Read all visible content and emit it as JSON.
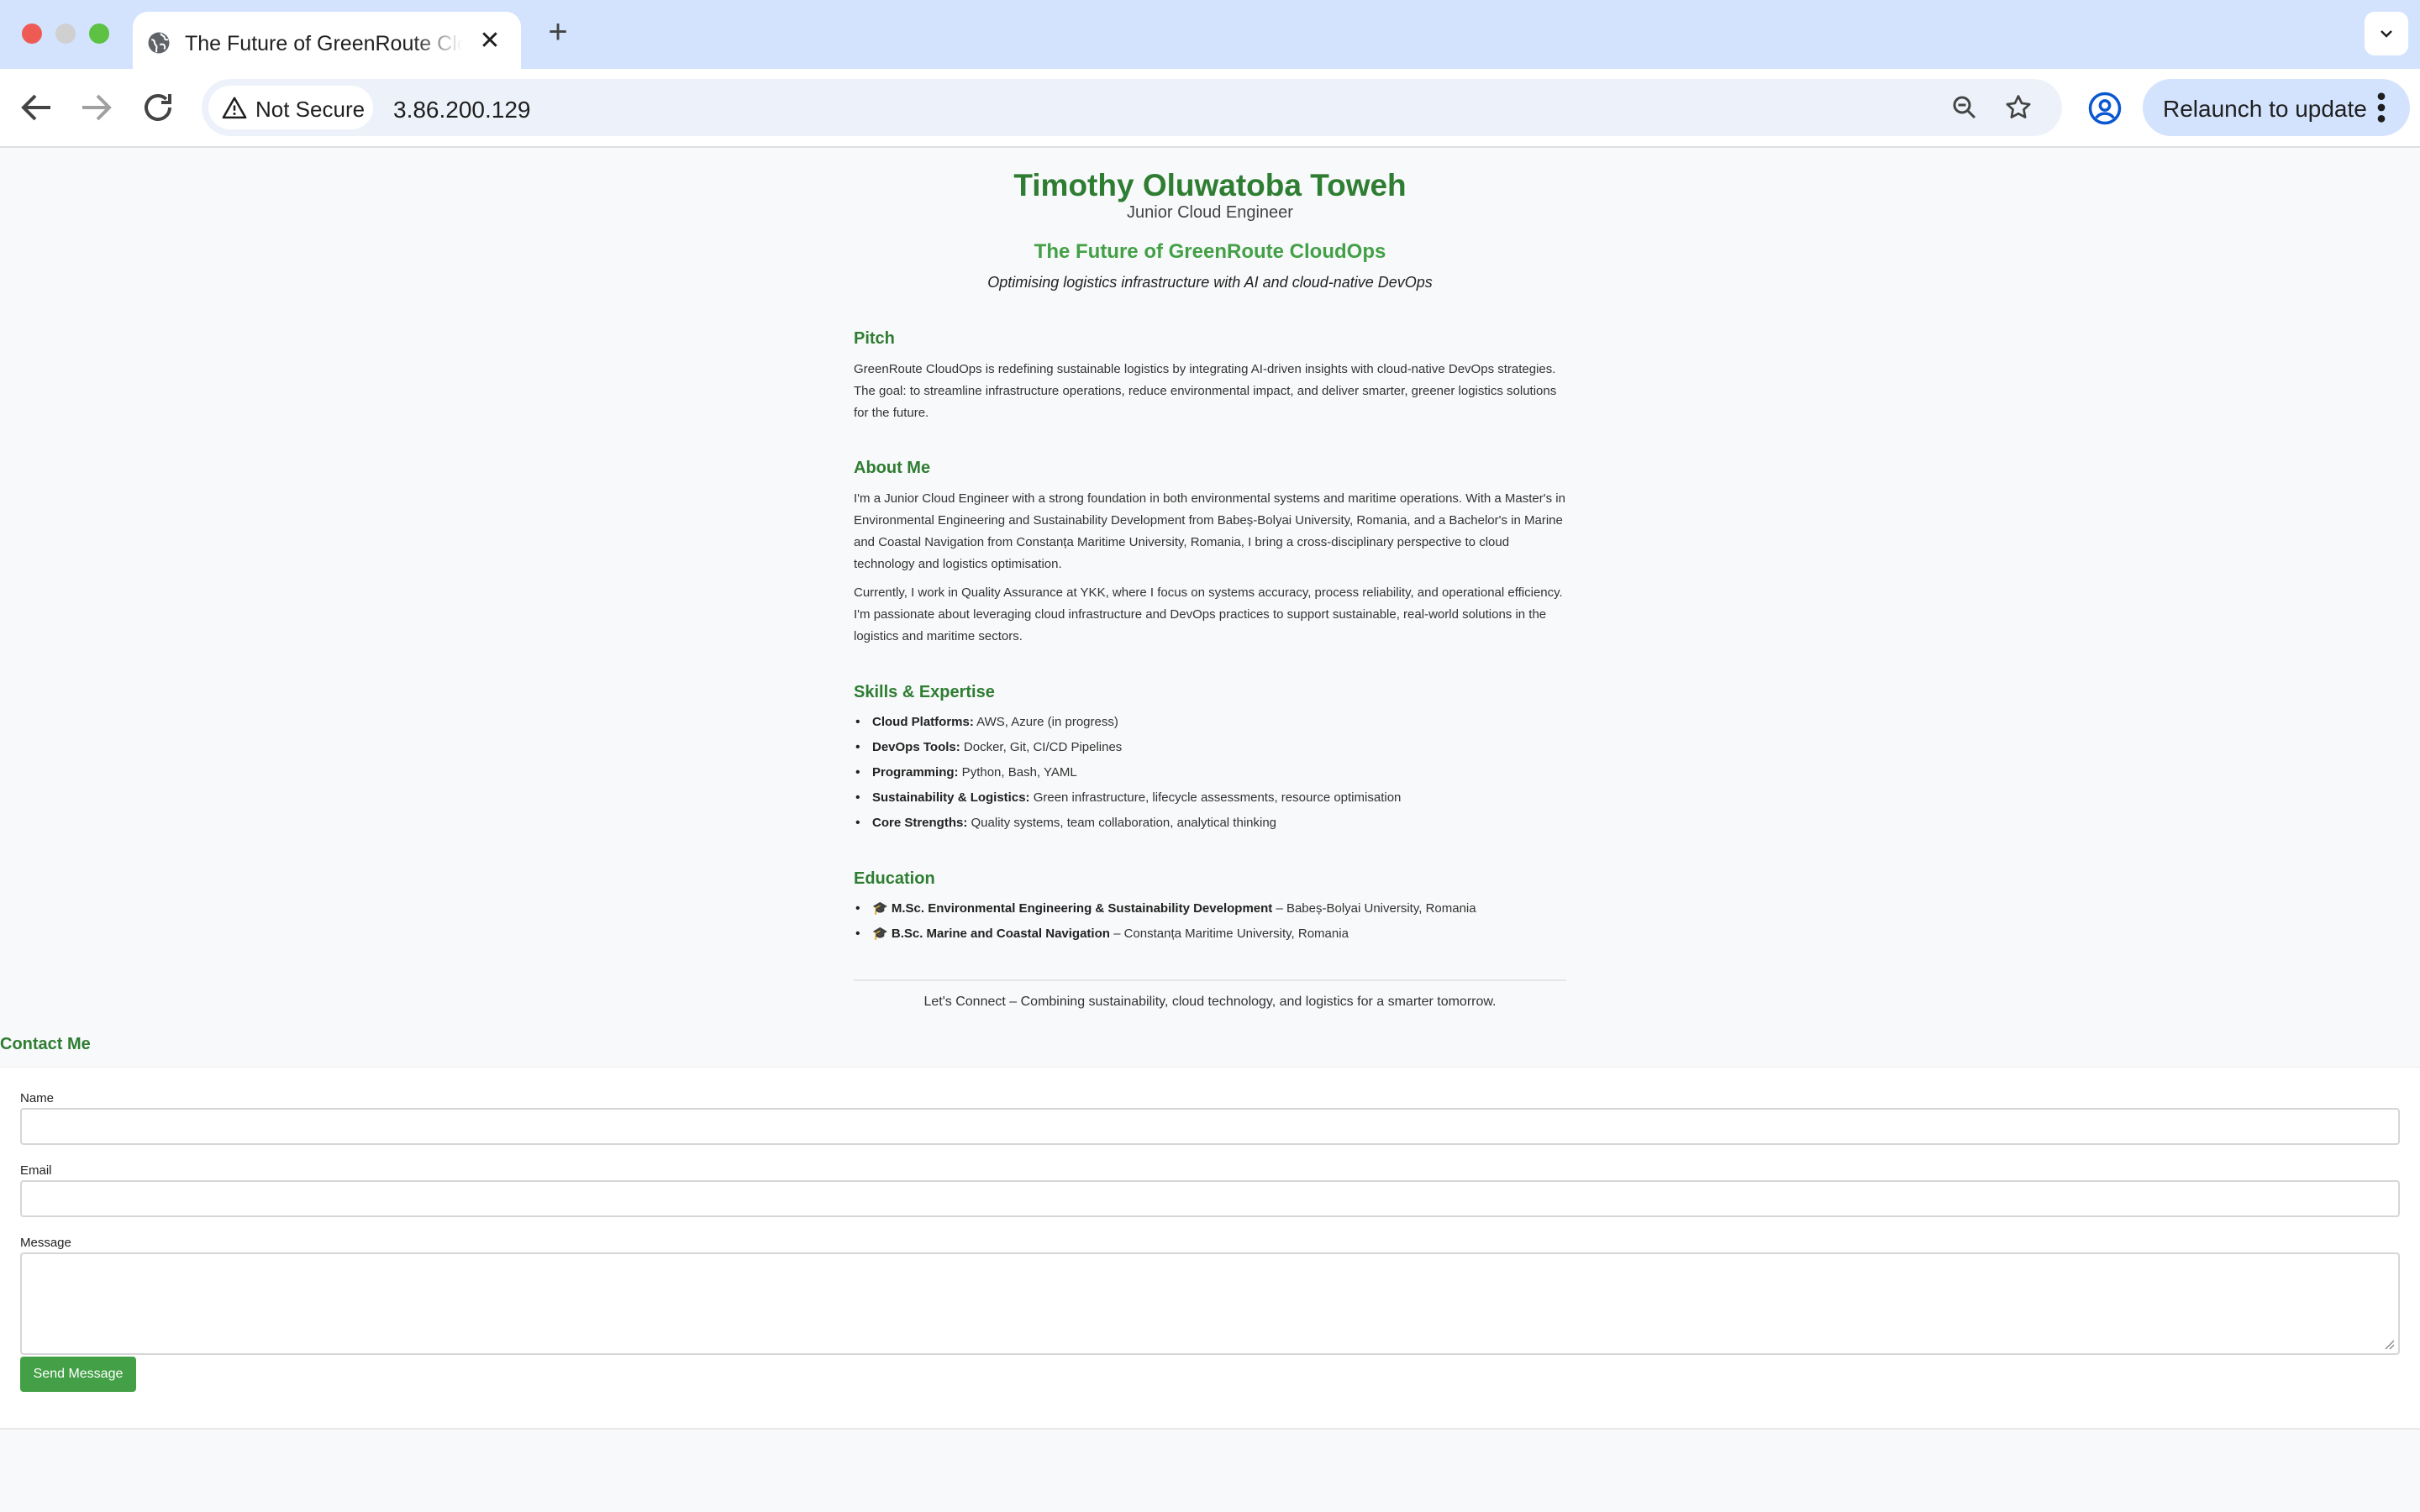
{
  "browser": {
    "tab_title": "The Future of GreenRoute CloudOps",
    "security_label": "Not Secure",
    "url": "3.86.200.129",
    "relaunch_label": "Relaunch to update"
  },
  "header": {
    "name": "Timothy Oluwatoba Toweh",
    "role": "Junior Cloud Engineer",
    "headline": "The Future of GreenRoute CloudOps",
    "tagline": "Optimising logistics infrastructure with AI and cloud-native DevOps"
  },
  "pitch": {
    "title": "Pitch",
    "text": "GreenRoute CloudOps is redefining sustainable logistics by integrating AI-driven insights with cloud-native DevOps strategies. The goal: to streamline infrastructure operations, reduce environmental impact, and deliver smarter, greener logistics solutions for the future."
  },
  "about": {
    "title": "About Me",
    "paragraphs": [
      "I'm a Junior Cloud Engineer with a strong foundation in both environmental systems and maritime operations. With a Master's in Environmental Engineering and Sustainability Development from Babeș-Bolyai University, Romania, and a Bachelor's in Marine and Coastal Navigation from Constanța Maritime University, Romania, I bring a cross-disciplinary perspective to cloud technology and logistics optimisation.",
      "Currently, I work in Quality Assurance at YKK, where I focus on systems accuracy, process reliability, and operational efficiency. I'm passionate about leveraging cloud infrastructure and DevOps practices to support sustainable, real-world solutions in the logistics and maritime sectors."
    ]
  },
  "skills": {
    "title": "Skills & Expertise",
    "items": [
      {
        "label": "Cloud Platforms:",
        "value": " AWS, Azure (in progress)"
      },
      {
        "label": "DevOps Tools:",
        "value": " Docker, Git, CI/CD Pipelines"
      },
      {
        "label": "Programming:",
        "value": " Python, Bash, YAML"
      },
      {
        "label": "Sustainability & Logistics:",
        "value": " Green infrastructure, lifecycle assessments, resource optimisation"
      },
      {
        "label": "Core Strengths:",
        "value": " Quality systems, team collaboration, analytical thinking"
      }
    ]
  },
  "education": {
    "title": "Education",
    "items": [
      {
        "icon": "🎓",
        "degree": "M.Sc. Environmental Engineering & Sustainability Development",
        "school": " – Babeș-Bolyai University, Romania"
      },
      {
        "icon": "🎓",
        "degree": "B.Sc. Marine and Coastal Navigation",
        "school": " – Constanța Maritime University, Romania"
      }
    ]
  },
  "footer": {
    "text": "Let's Connect – Combining sustainability, cloud technology, and logistics for a smarter tomorrow."
  },
  "contact": {
    "title": "Contact Me",
    "name_label": "Name",
    "name_value": "",
    "email_label": "Email",
    "email_value": "",
    "message_label": "Message",
    "message_value": "",
    "submit_label": "Send Message"
  },
  "colors": {
    "accent_dark": "#2e7d32",
    "accent": "#43a047",
    "tabbar": "#d3e3fd"
  }
}
